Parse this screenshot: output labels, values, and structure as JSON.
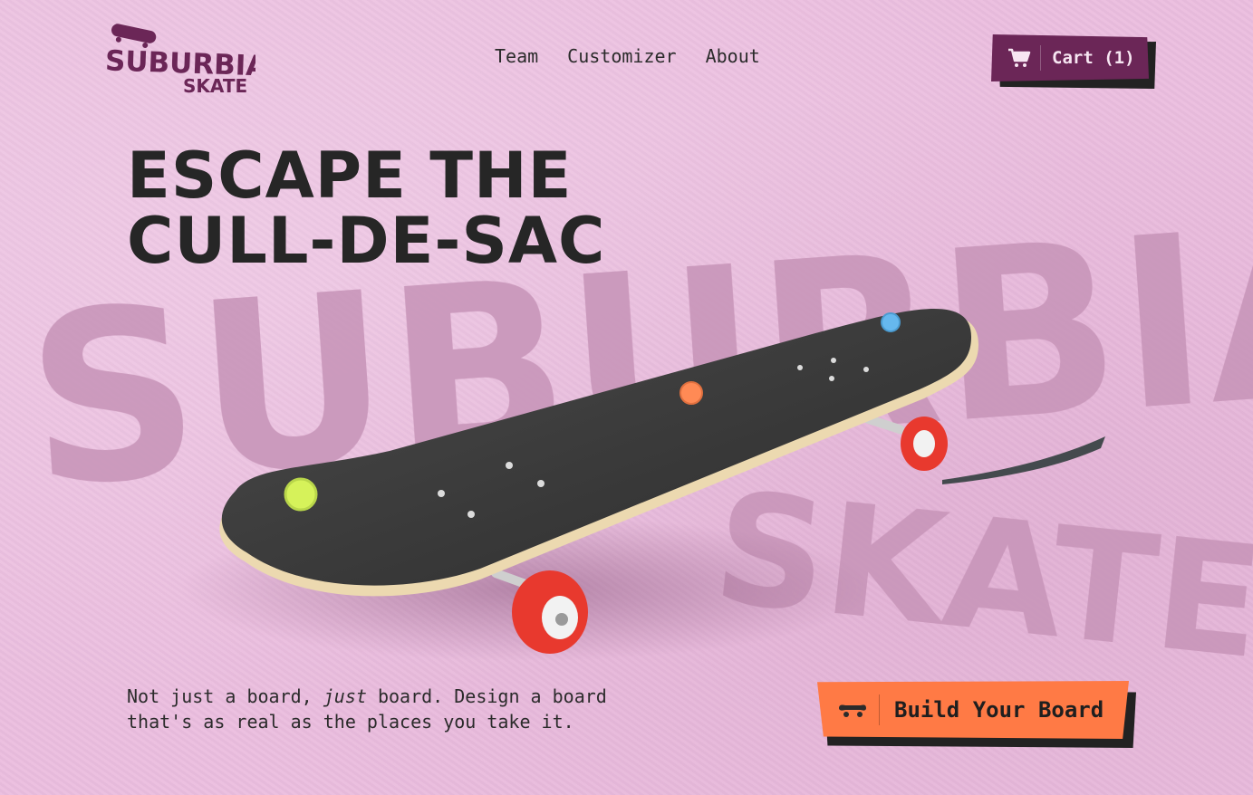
{
  "brand": {
    "logo_main": "SUBURBIA",
    "logo_sub": "SKATE"
  },
  "nav": {
    "items": [
      {
        "label": "Team"
      },
      {
        "label": "Customizer"
      },
      {
        "label": "About"
      }
    ]
  },
  "cart": {
    "label": "Cart (1)",
    "icon": "cart-icon"
  },
  "hero": {
    "headline_line1": "ESCAPE THE",
    "headline_line2": "CULL-DE-SAC",
    "tagline_part1": "Not just a board, ",
    "tagline_em": "just",
    "tagline_part2": " board. Design a board that's as real as the places you take it.",
    "cta_label": "Build Your Board",
    "cta_icon": "skateboard-icon"
  },
  "background_word": {
    "main": "SUBURBIA",
    "sub": "SKATE"
  },
  "colors": {
    "background": "#ebbedf",
    "brand": "#6b2657",
    "cta": "#ff7a45",
    "hotspot_lime": "#d6f25a",
    "hotspot_orange": "#ff8a55",
    "hotspot_blue": "#66b8ee",
    "wheel": "#e8392e"
  }
}
